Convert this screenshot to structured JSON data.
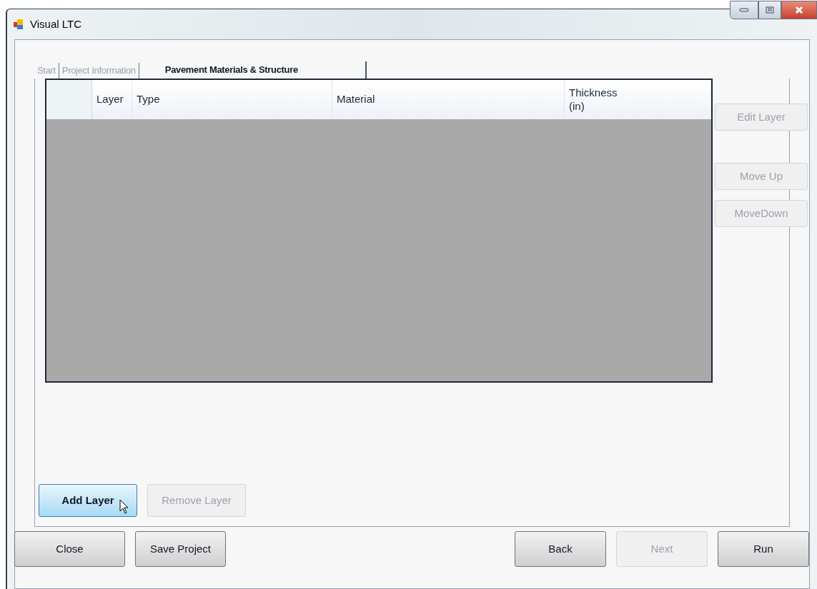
{
  "window": {
    "title": "Visual LTC"
  },
  "tabs": [
    {
      "label": "Start",
      "selected": false
    },
    {
      "label": "Project Information",
      "selected": false
    },
    {
      "label": "Pavement Materials & Structure",
      "selected": true
    }
  ],
  "table": {
    "columns": [
      "Layer",
      "Type",
      "Material",
      "Thickness\n(in)"
    ]
  },
  "side_buttons": [
    {
      "label": "Edit Layer",
      "disabled": true
    },
    {
      "label": "Move Up",
      "disabled": true
    },
    {
      "label": "MoveDown",
      "disabled": true
    }
  ],
  "layer_buttons": [
    {
      "label": "Add Layer",
      "disabled": false,
      "hovered": true
    },
    {
      "label": "Remove Layer",
      "disabled": true,
      "hovered": false
    }
  ],
  "footer_left": [
    {
      "label": "Close",
      "disabled": false
    },
    {
      "label": "Save Project",
      "disabled": false
    }
  ],
  "footer_right": [
    {
      "label": "Back",
      "disabled": false
    },
    {
      "label": "Next",
      "disabled": true
    },
    {
      "label": "Run",
      "disabled": false
    }
  ]
}
